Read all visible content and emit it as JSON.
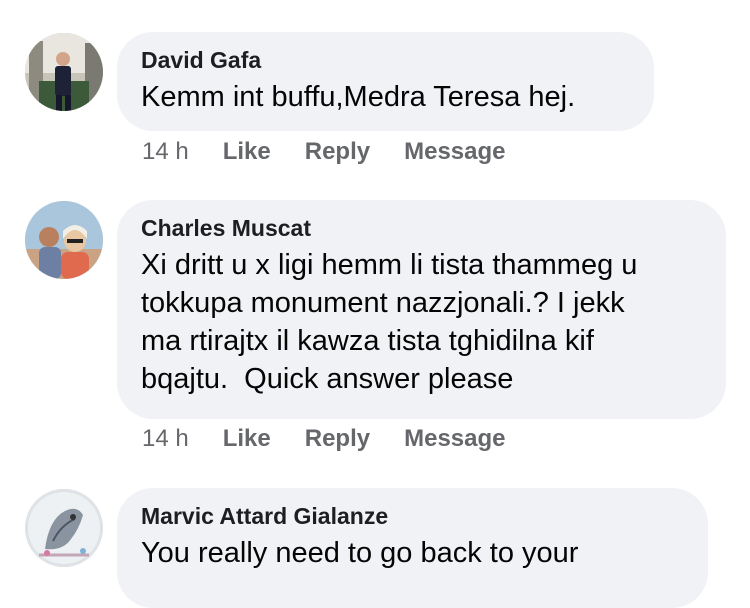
{
  "comments": [
    {
      "author": "David Gafa",
      "text": "Kemm int buffu,Medra Teresa hej.",
      "time": "14 h",
      "actions": [
        "Like",
        "Reply",
        "Message"
      ]
    },
    {
      "author": "Charles Muscat",
      "lines": [
        "Xi dritt u x ligi hemm li tista thammeg u",
        "tokkupa monument nazzjonali.? I jekk",
        "ma rtirajtx il kawza tista tghidilna kif",
        "bqajtu.  Quick answer please"
      ],
      "time": "14 h",
      "actions": [
        "Like",
        "Reply",
        "Message"
      ]
    },
    {
      "author": "Marvic Attard Gialanze",
      "text": "You really need to go back to your"
    }
  ]
}
